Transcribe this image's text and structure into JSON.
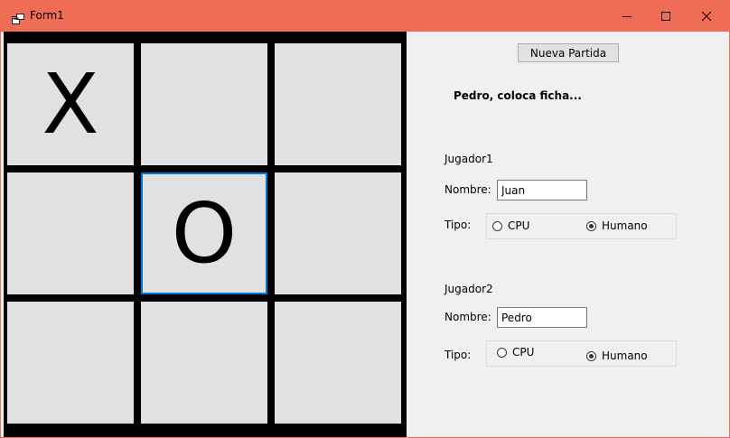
{
  "window": {
    "title": "Form1",
    "accent_color": "#ef6d55"
  },
  "board": {
    "cells": [
      "X",
      "",
      "",
      "",
      "O",
      "",
      "",
      "",
      ""
    ],
    "focused_cell": 4
  },
  "controls": {
    "new_game_label": "Nueva Partida",
    "status_text": "Pedro, coloca ficha..."
  },
  "player1": {
    "heading": "Jugador1",
    "name_label": "Nombre:",
    "name_value": "Juan",
    "type_label": "Tipo:",
    "option_cpu": "CPU",
    "option_human": "Humano",
    "selected": "Humano"
  },
  "player2": {
    "heading": "Jugador2",
    "name_label": "Nombre:",
    "name_value": "Pedro",
    "type_label": "Tipo:",
    "option_cpu": "CPU",
    "option_human": "Humano",
    "selected": "Humano"
  }
}
